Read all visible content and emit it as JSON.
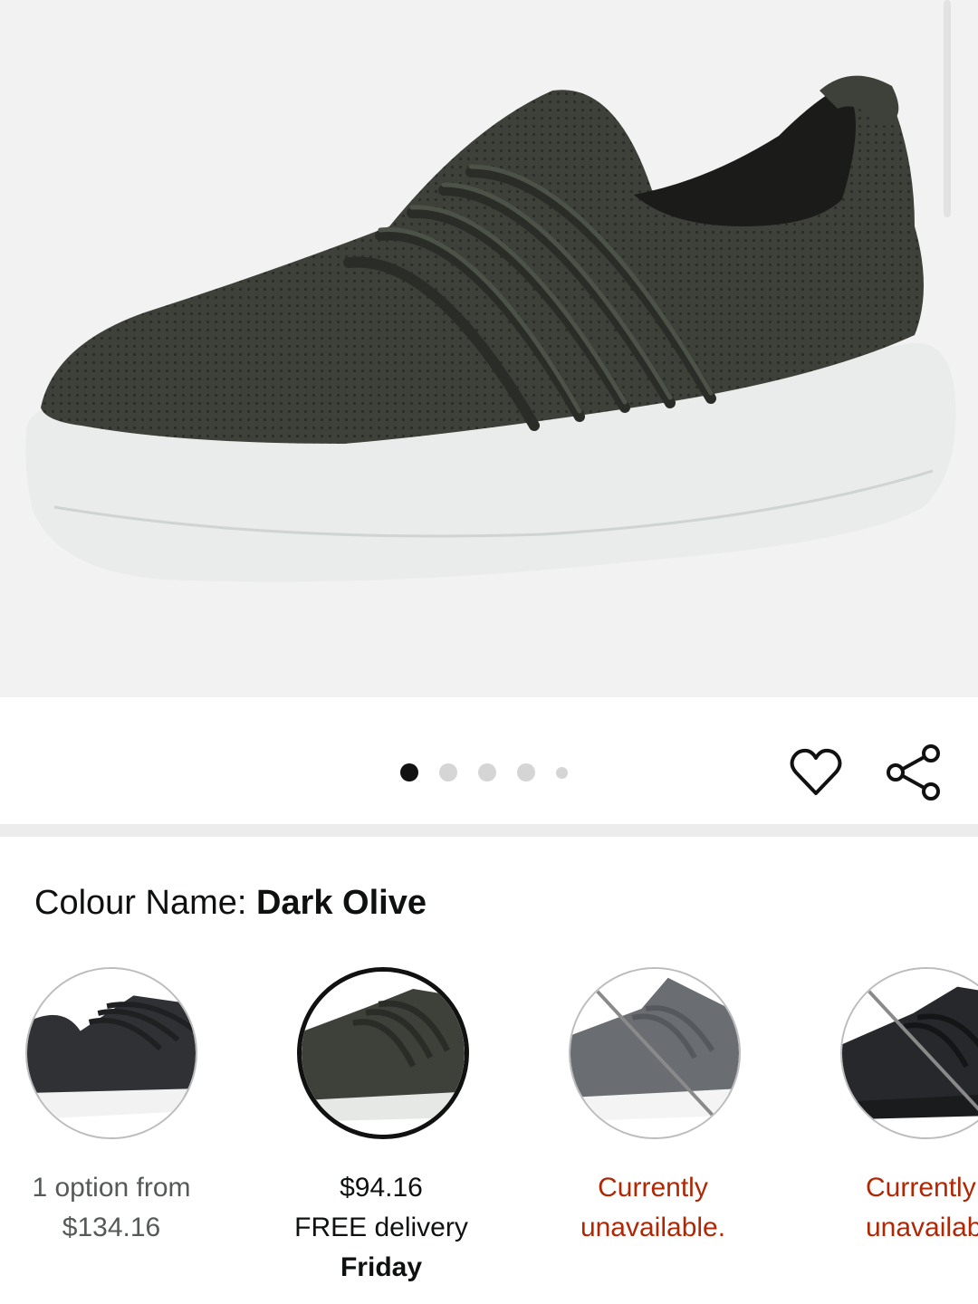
{
  "product": {
    "image_alt": "Dark olive knit slip-on sneaker with white sole",
    "image_count": 5,
    "current_image": 1
  },
  "actions": {
    "wishlist_icon": "heart-icon",
    "share_icon": "share-icon"
  },
  "colour": {
    "label": "Colour Name:",
    "selected_name": "Dark Olive"
  },
  "swatches": [
    {
      "name": "black-white",
      "line1": "1 option from",
      "line2": "$134.16",
      "line3": "",
      "available": true,
      "selected": false
    },
    {
      "name": "dark-olive",
      "line1": "$94.16",
      "line2": "FREE delivery",
      "line3": "Friday",
      "available": true,
      "selected": true
    },
    {
      "name": "grey",
      "line1": "Currently",
      "line2": "unavailable.",
      "line3": "",
      "available": false,
      "selected": false
    },
    {
      "name": "black",
      "line1": "Currently",
      "line2": "unavailable.",
      "line3": "",
      "available": false,
      "selected": false
    }
  ],
  "colors": {
    "unavailable_text": "#b12704",
    "dot_active": "#111111",
    "dot_inactive": "#d5d5d5",
    "shoe_upper": "#3a3e37"
  }
}
